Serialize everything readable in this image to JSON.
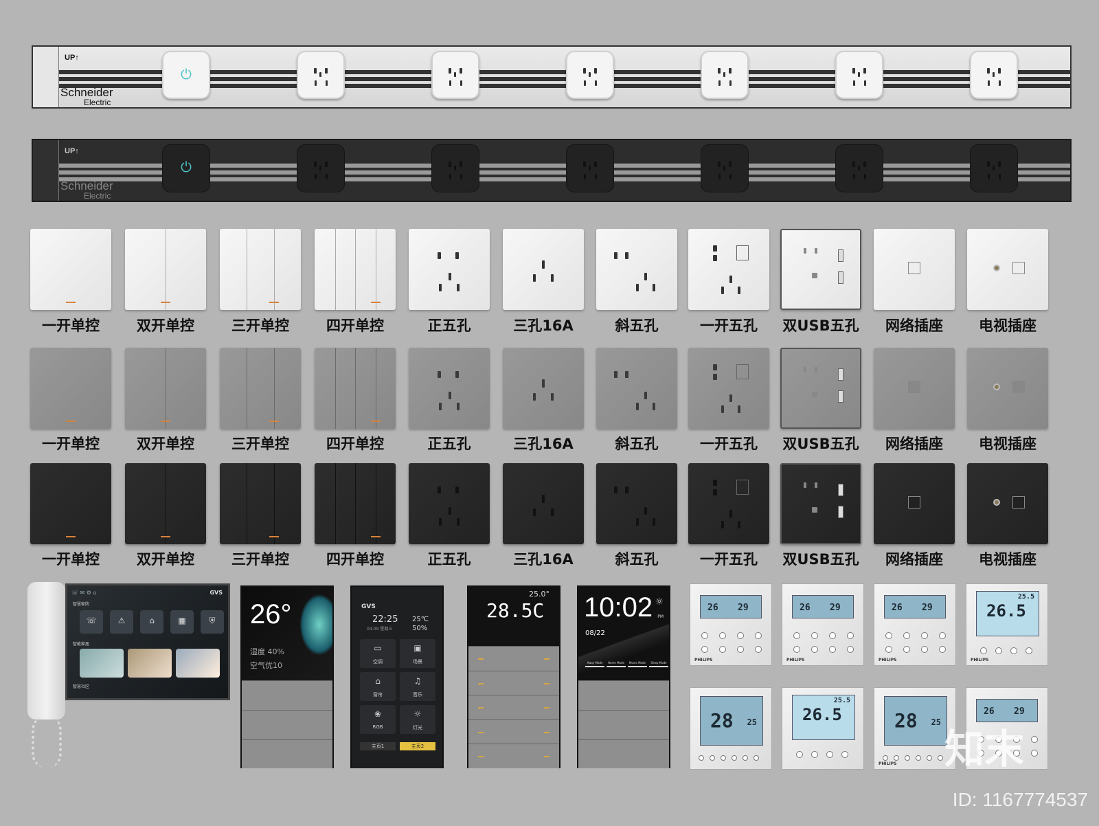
{
  "strips": {
    "up_label": "UP↑",
    "brand_line1": "Schneider",
    "brand_line2": "Electric",
    "power_icon": "⏻"
  },
  "rows": [
    {
      "color": "white",
      "labels": [
        "一开单控",
        "双开单控",
        "三开单控",
        "四开单控",
        "正五孔",
        "三孔16A",
        "斜五孔",
        "一开五孔",
        "双USB五孔",
        "网络插座",
        "电视插座"
      ]
    },
    {
      "color": "grey",
      "labels": [
        "一开单控",
        "双开单控",
        "三开单控",
        "四开单控",
        "正五孔",
        "三孔16A",
        "斜五孔",
        "一开五孔",
        "双USB五孔",
        "网络插座",
        "电视插座"
      ]
    },
    {
      "color": "black",
      "labels": [
        "一开单控",
        "双开单控",
        "三开单控",
        "四开单控",
        "正五孔",
        "三孔16A",
        "斜五孔",
        "一开五孔",
        "双USB五孔",
        "网络插座",
        "电视插座"
      ]
    }
  ],
  "intercom": {
    "brand": "GVS",
    "section1": "智慧家防",
    "section2": "智能家居",
    "section3": "智慧社区",
    "tiles": [
      "电话",
      "报警",
      "回家",
      "离家",
      "撤防"
    ]
  },
  "panel_weather": {
    "temp": "26°",
    "humidity": "湿度 40%",
    "air": "空气优10"
  },
  "panel_gvs": {
    "brand": "GVS",
    "time": "22:25",
    "date": "04-09 星期三",
    "temp": "25℃",
    "hum": "50%",
    "tiles": [
      "空调",
      "场景",
      "窗帘",
      "音乐",
      "RGB",
      "灯光"
    ],
    "tabs": [
      "主页1",
      "主页2"
    ]
  },
  "panel_ac": {
    "set": "25.0°",
    "temp": "28.5C"
  },
  "panel_clock": {
    "time": "10:02",
    "ampm": "PM",
    "date": "08/22",
    "modes": [
      "Away Mode",
      "Home Mode",
      "Movie Mode",
      "Sleep Mode"
    ]
  },
  "thermostats": [
    {
      "type": "dual",
      "a": "26",
      "b": "29",
      "brand": "PHILIPS"
    },
    {
      "type": "dual",
      "a": "26",
      "b": "29",
      "brand": "PHILIPS"
    },
    {
      "type": "dual",
      "a": "26",
      "b": "29",
      "brand": "PHILIPS"
    },
    {
      "type": "single",
      "a": "26.5",
      "small": "25.5",
      "brand": "PHILIPS"
    },
    {
      "type": "big",
      "a": "28",
      "small": "25"
    },
    {
      "type": "single",
      "a": "26.5",
      "small": "25.5"
    },
    {
      "type": "big",
      "a": "28",
      "small": "25",
      "brand": "PHILIPS"
    },
    {
      "type": "dual",
      "a": "26",
      "b": "29"
    }
  ],
  "watermark": {
    "id": "ID: 1167774537",
    "logo": "知末"
  },
  "colors": {
    "accent": "#4cc3c8",
    "led": "#d8823a",
    "background": "#b5b5b5"
  }
}
